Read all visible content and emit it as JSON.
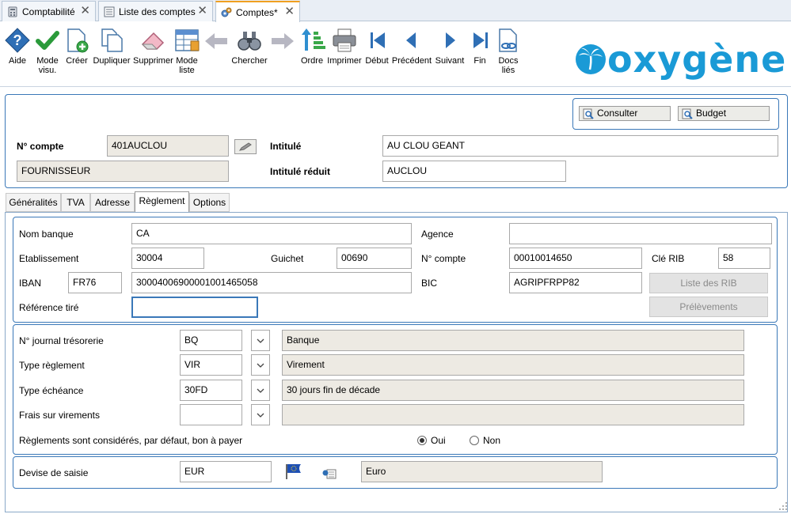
{
  "tabs": [
    {
      "label": "Comptabilité",
      "icon": "calculator-icon",
      "active": false
    },
    {
      "label": "Liste des comptes",
      "icon": "list-icon",
      "active": false
    },
    {
      "label": "Comptes*",
      "icon": "gears-icon",
      "active": true
    }
  ],
  "toolbar": {
    "aide": "Aide",
    "mode_visu_1": "Mode",
    "mode_visu_2": "visu.",
    "creer": "Créer",
    "dupliquer": "Dupliquer",
    "supprimer": "Supprimer",
    "mode_liste_1": "Mode",
    "mode_liste_2": "liste",
    "chercher": "Chercher",
    "ordre": "Ordre",
    "imprimer": "Imprimer",
    "debut": "Début",
    "precedent": "Précédent",
    "suivant": "Suivant",
    "fin": "Fin",
    "docs_1": "Docs",
    "docs_2": "liés"
  },
  "brand": {
    "logo_text": "oxygène",
    "color": "#1a9ad6"
  },
  "header": {
    "consulter": "Consulter",
    "budget": "Budget",
    "n_compte_label": "N° compte",
    "n_compte_value": "401AUCLOU",
    "type_value": "FOURNISSEUR",
    "intitule_label": "Intitulé",
    "intitule_value": "AU CLOU GEANT",
    "intitule_reduit_label": "Intitulé réduit",
    "intitule_reduit_value": "AUCLOU"
  },
  "subtabs": [
    "Généralités",
    "TVA",
    "Adresse",
    "Règlement",
    "Options"
  ],
  "bank": {
    "nom_banque_label": "Nom banque",
    "nom_banque_value": "CA",
    "agence_label": "Agence",
    "agence_value": "",
    "etablissement_label": "Etablissement",
    "etablissement_value": "30004",
    "guichet_label": "Guichet",
    "guichet_value": "00690",
    "n_compte_label": "N° compte",
    "n_compte_value": "00010014650",
    "cle_rib_label": "Clé RIB",
    "cle_rib_value": "58",
    "iban_label": "IBAN",
    "iban_prefix": "FR76",
    "iban_value": "30004006900001001465058",
    "bic_label": "BIC",
    "bic_value": "AGRIPFRPP82",
    "reference_tire_label": "Référence tiré",
    "reference_tire_value": "",
    "liste_rib": "Liste des RIB",
    "prelevements": "Prélèvements"
  },
  "reglement": {
    "journal_label": "N° journal trésorerie",
    "journal_code": "BQ",
    "journal_desc": "Banque",
    "type_reglement_label": "Type règlement",
    "type_reglement_code": "VIR",
    "type_reglement_desc": "Virement",
    "type_echeance_label": "Type échéance",
    "type_echeance_code": "30FD",
    "type_echeance_desc": "30 jours fin de décade",
    "frais_label": "Frais sur virements",
    "frais_code": "",
    "frais_desc": "",
    "bon_a_payer_label": "Règlements sont considérés, par défaut, bon à payer",
    "oui": "Oui",
    "non": "Non",
    "bon_a_payer_selected": "Oui"
  },
  "devise": {
    "label": "Devise de saisie",
    "code": "EUR",
    "desc": "Euro"
  }
}
